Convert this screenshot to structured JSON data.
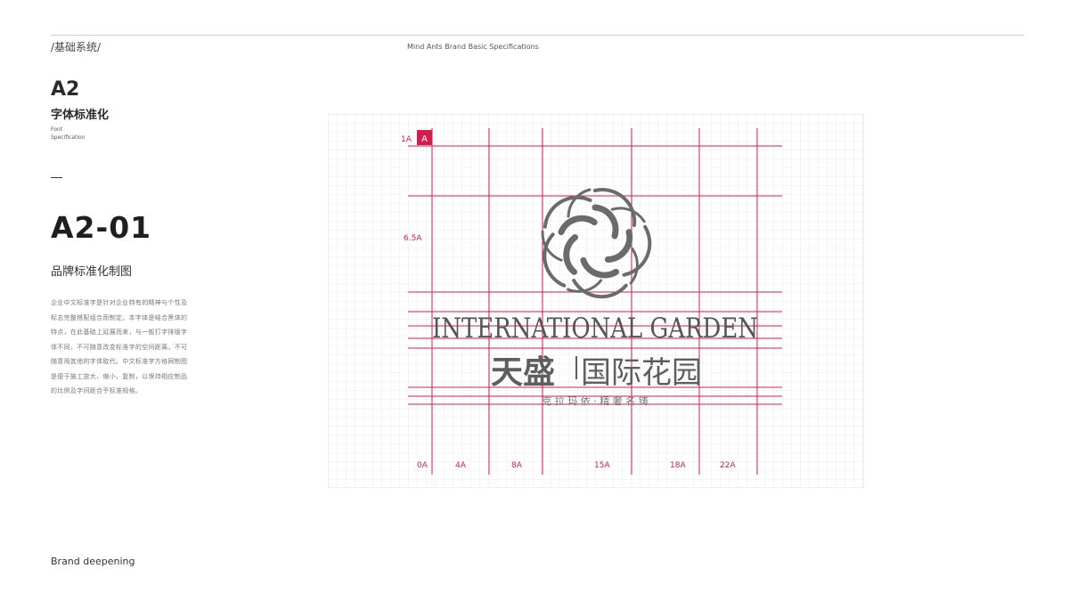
{
  "header": {
    "section_path": "/基础系统/",
    "subtitle": "Mind Ants Brand Basic Specifications"
  },
  "chapter": {
    "code": "A2",
    "title": "字体标准化",
    "en_line1": "Font",
    "en_line2": "Specification"
  },
  "section": {
    "code": "A2-01",
    "title": "品牌标准化制图",
    "description": "企业中文标准字是针对企业特有的精神与个性及标志完整搭配组合而制定。本字体是结合黑体的特点，在此基础上延展而来，与一般打字排版字体不同，不可随意改变标准字的空间距离，不可随意用其他的字体取代。中文标准字方格网制图是便于施工放大、缩小、复制，以保持相应制品的比例及字间距合乎标准规格。"
  },
  "diagram": {
    "unit_label": "1A",
    "unit_mark": "A",
    "height_label": "6.5A",
    "bottom_labels": [
      "0A",
      "4A",
      "8A",
      "15A",
      "18A",
      "22A"
    ],
    "brand_en": "INTERNATIONAL GARDEN",
    "brand_cn_left": "天盛",
    "brand_cn_right": "国际花园",
    "slogan": "克 拉 玛 依 · 精 奢 名 铸",
    "colors": {
      "guide": "#d21e4d",
      "grid": "#e6e6e6",
      "logo": "#6b6b6b"
    }
  },
  "footer": {
    "tagline": "Brand deepening"
  }
}
